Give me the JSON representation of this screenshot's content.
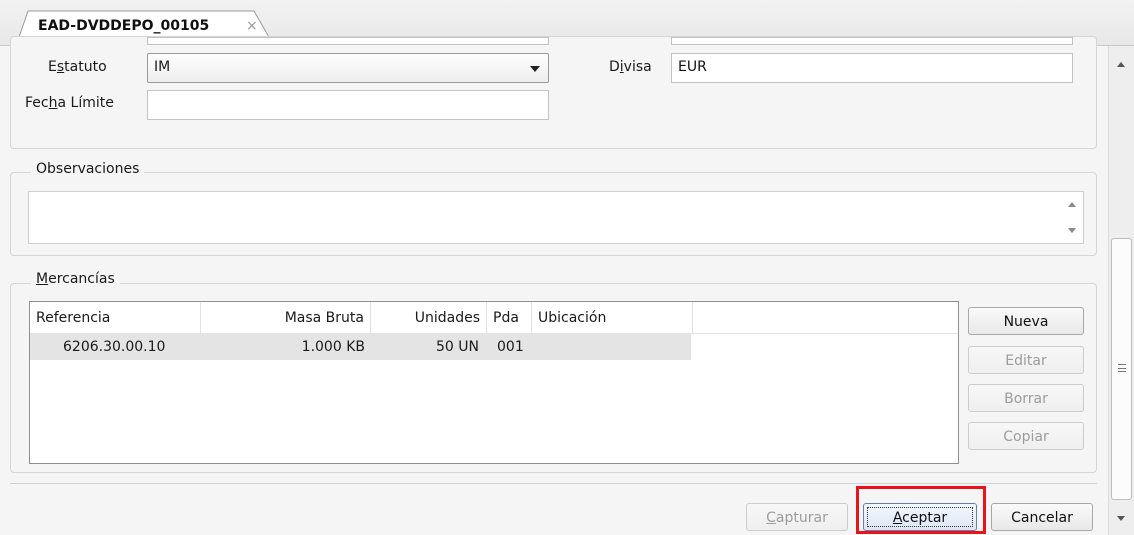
{
  "tab": {
    "title": "EAD-DVDDEPO_00105",
    "close_glyph": "×"
  },
  "form": {
    "estatuto": {
      "label_pre": "E",
      "label_key": "s",
      "label_post": "tatuto",
      "value": "IM"
    },
    "fecha_limite": {
      "label_pre": "Fec",
      "label_key": "h",
      "label_post": "a Límite",
      "value": ""
    },
    "divisa": {
      "label_pre": "D",
      "label_key": "i",
      "label_post": "visa",
      "value": "EUR"
    }
  },
  "observaciones": {
    "title": "Observaciones",
    "value": ""
  },
  "mercancias": {
    "title_key": "M",
    "title_rest": "ercancías",
    "columns": [
      "Referencia",
      "Masa Bruta",
      "Unidades",
      "Pda",
      "Ubicación"
    ],
    "rows": [
      {
        "referencia": "6206.30.00.10",
        "masa_bruta": "1.000 KB",
        "unidades": "50 UN",
        "pda": "001",
        "ubicacion": ""
      }
    ],
    "buttons": {
      "nueva": "Nueva",
      "editar": "Editar",
      "borrar": "Borrar",
      "copiar": "Copiar"
    }
  },
  "footer": {
    "capturar": {
      "key": "C",
      "rest": "apturar"
    },
    "aceptar": {
      "key": "A",
      "rest": "ceptar"
    },
    "cancelar": "Cancelar"
  },
  "colors": {
    "highlight": "#e8141c",
    "background": "#f5f5f5"
  }
}
